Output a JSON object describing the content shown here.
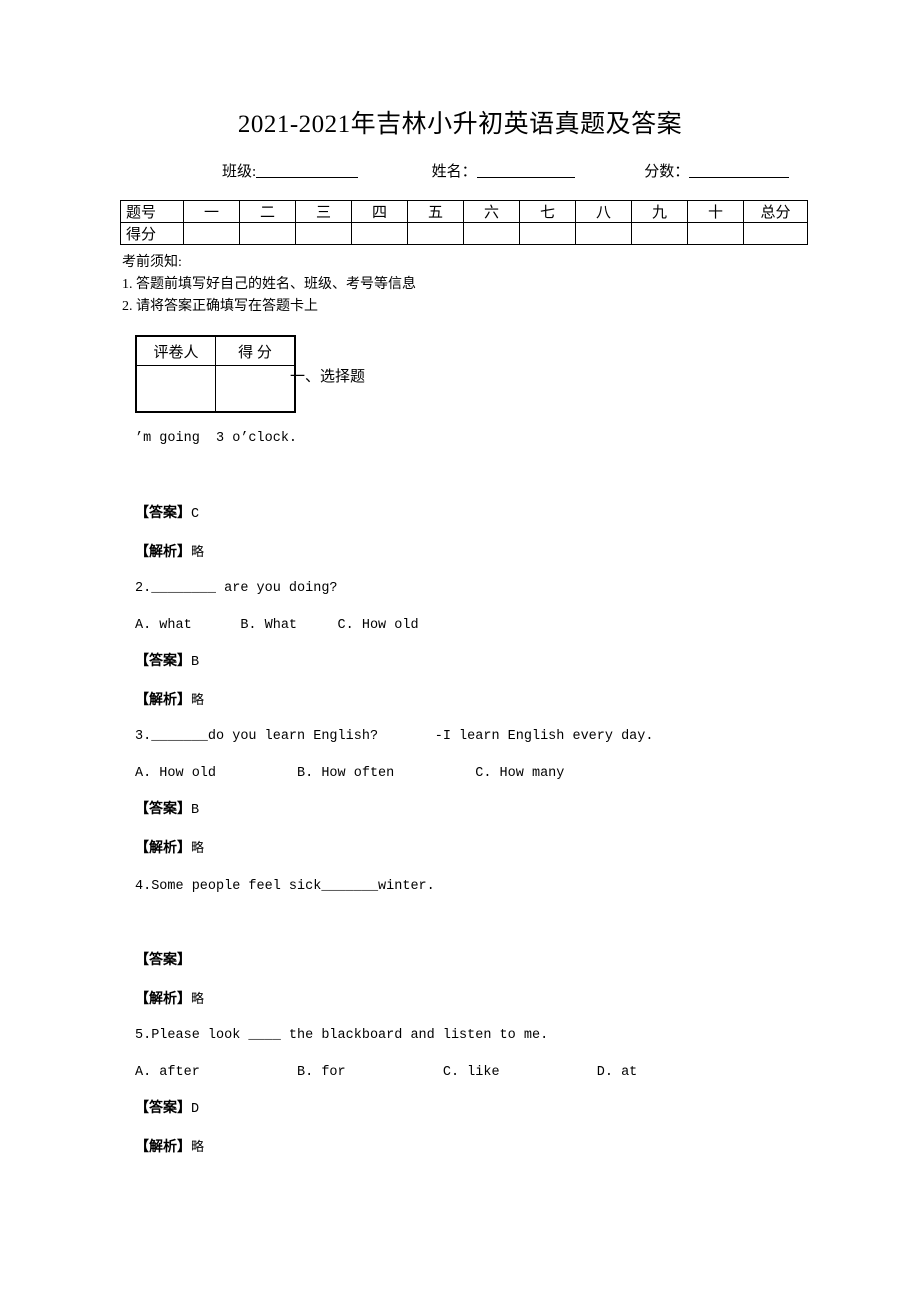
{
  "document": {
    "title": "2021-2021年吉林小升初英语真题及答案"
  },
  "identity": {
    "class_label": "班级:",
    "name_label": "姓名：",
    "score_label": "分数：",
    "blank": ""
  },
  "score_table": {
    "row_labels": [
      "题号",
      "得分"
    ],
    "columns": [
      "一",
      "二",
      "三",
      "四",
      "五",
      "六",
      "七",
      "八",
      "九",
      "十",
      "总分"
    ],
    "scores": [
      "",
      "",
      "",
      "",
      "",
      "",
      "",
      "",
      "",
      "",
      ""
    ]
  },
  "notes": {
    "heading": "考前须知:",
    "items": [
      "1. 答题前填写好自己的姓名、班级、考号等信息",
      "2. 请将答案正确填写在答题卡上"
    ]
  },
  "grader_box": {
    "header_left": "评卷人",
    "header_right": "得  分",
    "value_left": "",
    "value_right": ""
  },
  "section": {
    "title": "一、选择题"
  },
  "questions": [
    {
      "stem": "’m going  3 o’clock.",
      "options": "",
      "answer_tag": "【答案】",
      "answer": "C",
      "explain_tag": "【解析】",
      "explain": "略"
    },
    {
      "stem": "2.________ are you doing?",
      "options": "A. what      B. What     C. How old",
      "answer_tag": "【答案】",
      "answer": "B",
      "explain_tag": "【解析】",
      "explain": "略"
    },
    {
      "stem": "3._______do you learn English?       -I learn English every day.",
      "options": "A. How old          B. How often          C. How many",
      "answer_tag": "【答案】",
      "answer": "B",
      "explain_tag": "【解析】",
      "explain": "略"
    },
    {
      "stem": "4.Some people feel sick_______winter.",
      "options": "",
      "answer_tag": "【答案】",
      "answer": "",
      "explain_tag": "【解析】",
      "explain": "略"
    },
    {
      "stem": "5.Please look ____ the blackboard and listen to me.",
      "options": "A. after            B. for            C. like            D. at",
      "answer_tag": "【答案】",
      "answer": "D",
      "explain_tag": "【解析】",
      "explain": "略"
    }
  ]
}
